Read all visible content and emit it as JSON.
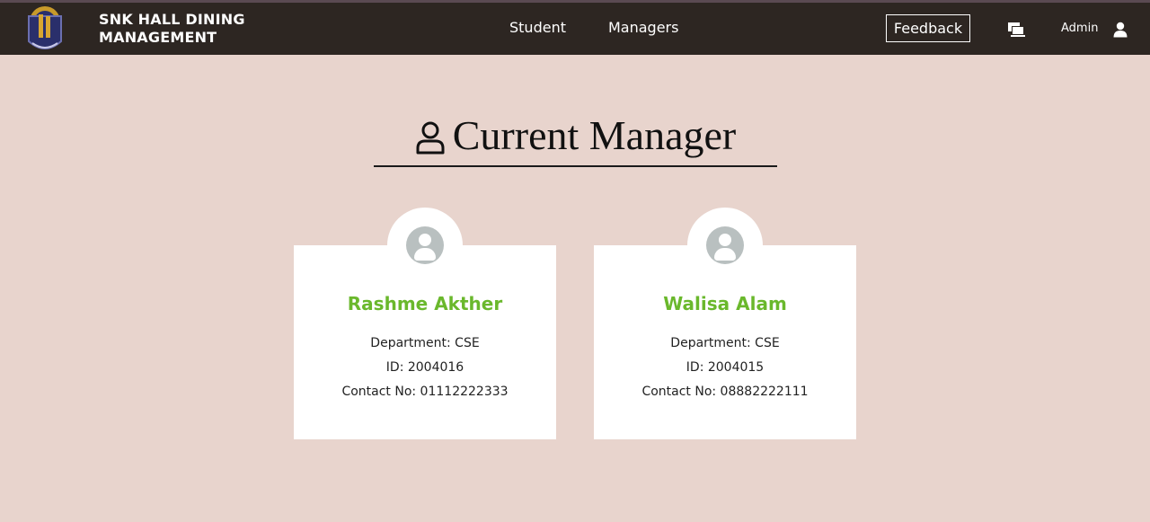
{
  "header": {
    "brand_line1": "SNK HALL DINING",
    "brand_line2": "MANAGEMENT",
    "nav": {
      "student": "Student",
      "managers": "Managers"
    },
    "feedback_label": "Feedback",
    "admin_label": "Admin",
    "icons": {
      "logo": "hall-logo-icon",
      "devices": "devices-icon",
      "user": "user-icon"
    }
  },
  "page": {
    "title": "Current Manager",
    "title_icon": "person-outline-icon"
  },
  "managers": [
    {
      "name": "Rashme Akther",
      "department": "Department: CSE",
      "id": "ID: 2004016",
      "contact": "Contact No: 01112222333"
    },
    {
      "name": "Walisa Alam",
      "department": "Department: CSE",
      "id": "ID: 2004015",
      "contact": "Contact No: 08882222111"
    }
  ],
  "colors": {
    "navbar": "#2d2622",
    "background": "#e8d4cd",
    "name_accent": "#6ab82c",
    "avatar": "#b9c0c0"
  }
}
